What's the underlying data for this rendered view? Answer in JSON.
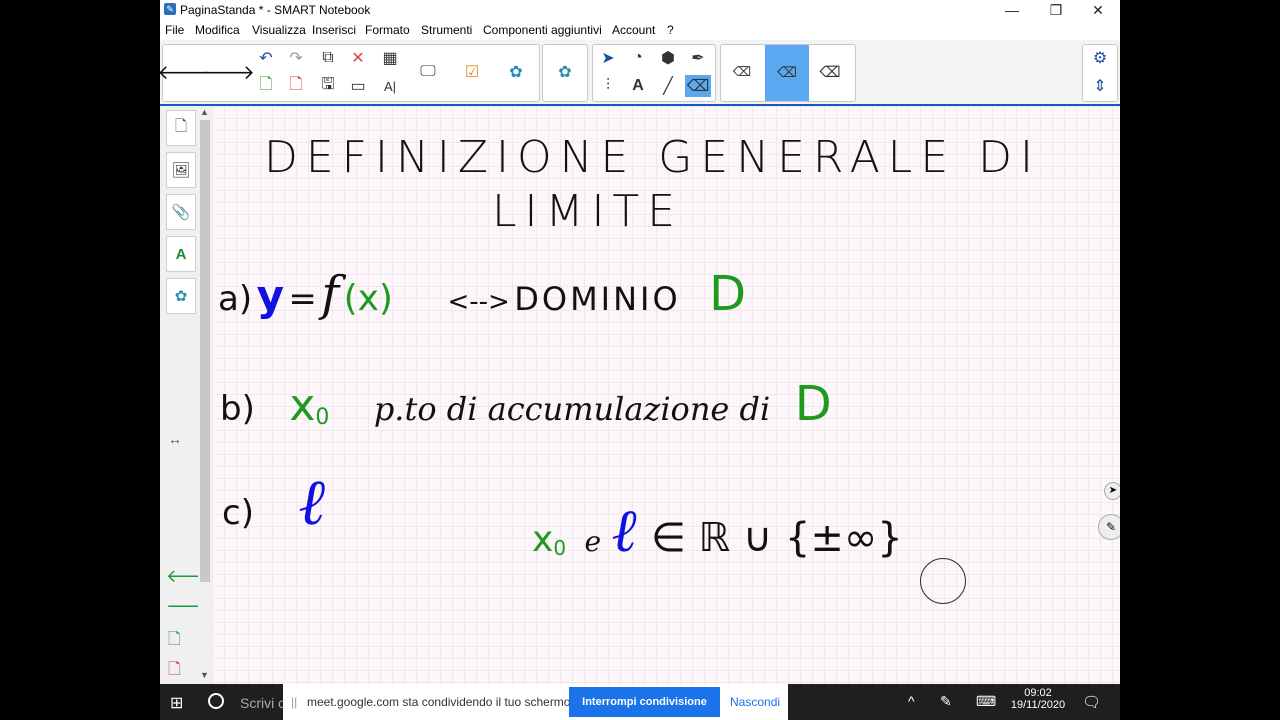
{
  "window": {
    "title": "PaginaStanda * - SMART Notebook"
  },
  "menu": [
    "File",
    "Modifica",
    "Visualizza",
    "Inserisci",
    "Formato",
    "Strumenti",
    "Componenti aggiuntivi",
    "Account",
    "?"
  ],
  "toolbar": {
    "icons": [
      "arrow-left-icon",
      "arrow-right-icon",
      "undo-icon",
      "redo-icon",
      "delete-icon",
      "table-icon",
      "screen-icon",
      "document-camera-icon",
      "puzzle-icon",
      "select-icon",
      "shapes-icon",
      "fill-icon",
      "pen-icon",
      "eraser-icon",
      "text-icon",
      "line-icon",
      "settings-icon"
    ],
    "selected_tool": "eraser"
  },
  "canvas": {
    "title_line1": "DEFINIZIONE GENERALE DI",
    "title_line2": "LIMITE",
    "item_a_label": "a)",
    "item_a_y": "y",
    "item_a_eq": "=",
    "item_a_f": "f",
    "item_a_x": "(x)",
    "item_a_arrow": "<-->",
    "item_a_text": "DOMINIO",
    "item_a_D": "D",
    "item_b_label": "b)",
    "item_b_x": "x",
    "item_b_sub": "0",
    "item_b_text": "p.to di accumulazione di",
    "item_b_D": "D",
    "item_c_label": "c)",
    "item_c_l": "ℓ",
    "item_c2_x": "x",
    "item_c2_sub": "0",
    "item_c2_e": "e",
    "item_c2_l": "ℓ",
    "item_c2_rest": "∈ ℝ ∪ {±∞}",
    "colors": {
      "blue": "#1010e0",
      "green": "#1f9a1f",
      "ink": "#111111"
    }
  },
  "taskbar": {
    "search_text": "Scrivi c",
    "share_message": "meet.google.com sta condividendo il tuo schermo.",
    "stop_button": "Interrompi condivisione",
    "hide_button": "Nascondi",
    "time": "09:02",
    "date": "19/11/2020"
  }
}
